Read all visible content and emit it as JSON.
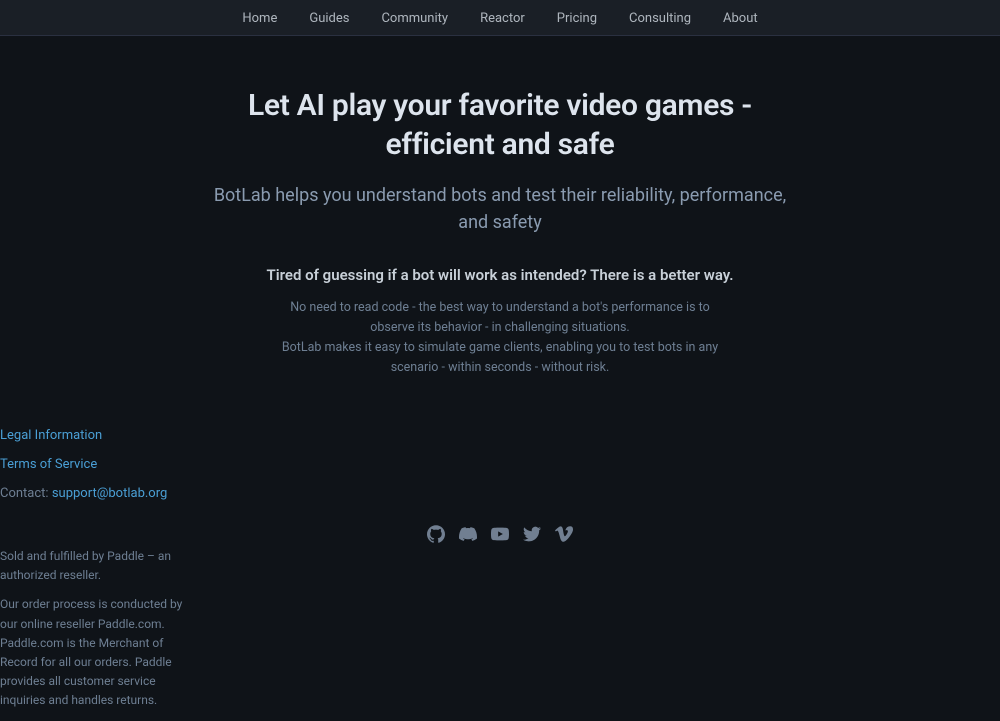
{
  "nav": {
    "items": [
      {
        "label": "Home",
        "href": "#"
      },
      {
        "label": "Guides",
        "href": "#"
      },
      {
        "label": "Community",
        "href": "#"
      },
      {
        "label": "Reactor",
        "href": "#"
      },
      {
        "label": "Pricing",
        "href": "#"
      },
      {
        "label": "Consulting",
        "href": "#"
      },
      {
        "label": "About",
        "href": "#"
      }
    ]
  },
  "hero": {
    "title": "Let AI play your favorite video games - efficient and safe",
    "subtitle": "BotLab helps you understand bots and test their reliability, performance, and safety",
    "tagline": "Tired of guessing if a bot will work as intended? There is a better way.",
    "description_line1": "No need to read code - the best way to understand a bot's performance is to observe its behavior - in challenging situations.",
    "description_line2": "BotLab makes it easy to simulate game clients, enabling you to test bots in any scenario - within seconds - without risk."
  },
  "footer": {
    "links": [
      {
        "label": "Legal Information",
        "href": "#"
      },
      {
        "label": "Terms of Service",
        "href": "#"
      }
    ],
    "contact_label": "Contact:",
    "contact_email": "support@botlab.org",
    "contact_href": "mailto:support@botlab.org",
    "sold_text": "Sold and fulfilled by Paddle – an authorized reseller.",
    "paddle_text": "Our order process is conducted by our online reseller Paddle.com. Paddle.com is the Merchant of Record for all our orders. Paddle provides all customer service inquiries and handles returns.",
    "social": [
      {
        "name": "github",
        "label": "GitHub"
      },
      {
        "name": "discord",
        "label": "Discord"
      },
      {
        "name": "youtube",
        "label": "YouTube"
      },
      {
        "name": "twitter",
        "label": "Twitter"
      },
      {
        "name": "vimeo",
        "label": "Vimeo"
      }
    ]
  }
}
